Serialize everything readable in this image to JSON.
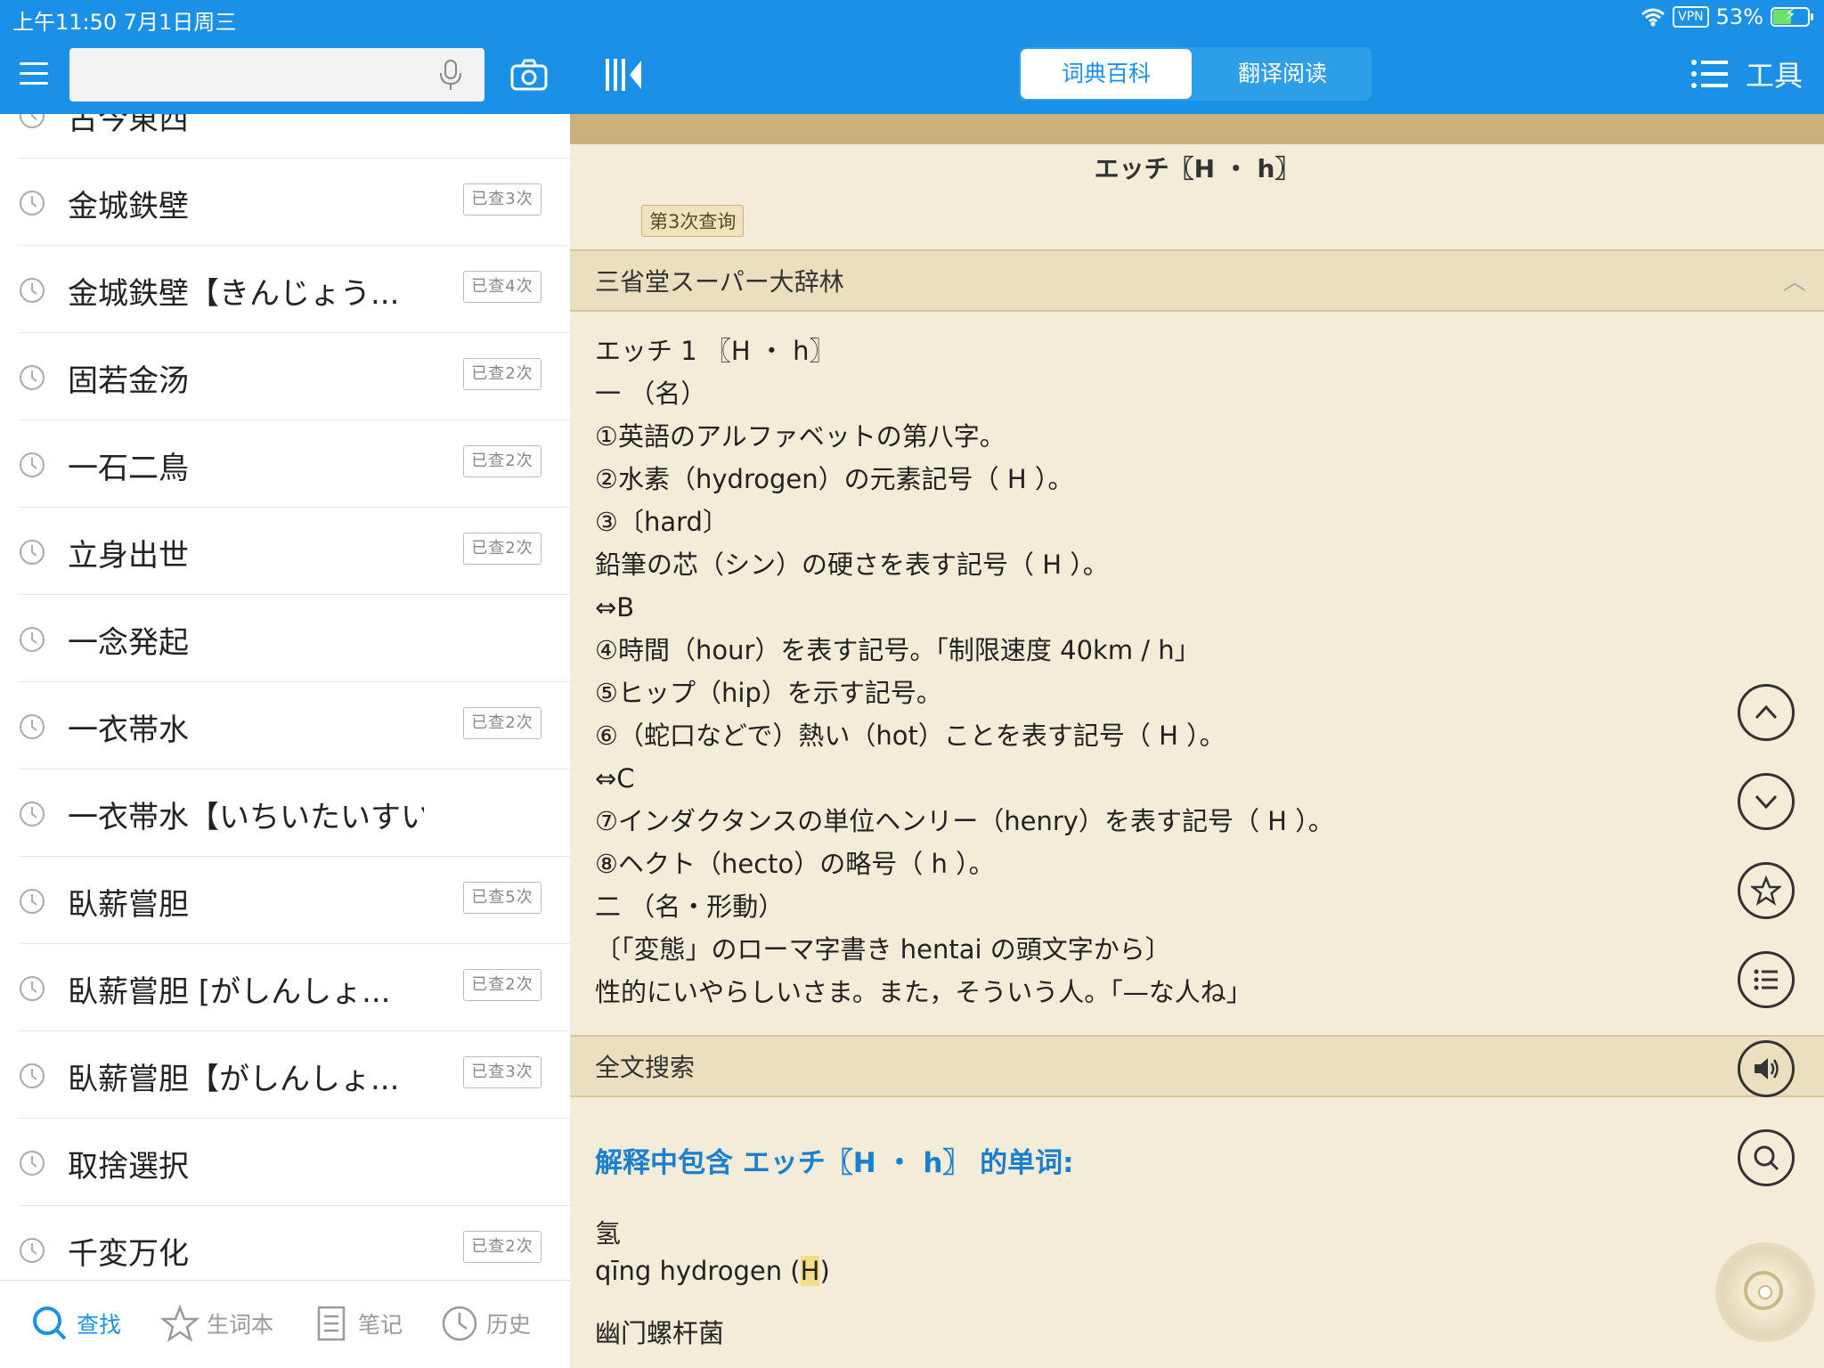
{
  "status": {
    "time": "上午11:50  7月1日周三",
    "vpn": "VPN",
    "battery": "53%"
  },
  "toolbar": {
    "search_placeholder": "",
    "segment": [
      "词典百科",
      "翻译阅读"
    ],
    "tools_label": "工具"
  },
  "history": [
    {
      "term": "古今東西",
      "count": ""
    },
    {
      "term": "金城鉄壁",
      "count": "已查3次"
    },
    {
      "term": "金城鉄壁【きんじょう...",
      "count": "已查4次"
    },
    {
      "term": "固若金汤",
      "count": "已查2次"
    },
    {
      "term": "一石二鳥",
      "count": "已查2次"
    },
    {
      "term": "立身出世",
      "count": "已查2次"
    },
    {
      "term": "一念発起",
      "count": ""
    },
    {
      "term": "一衣帯水",
      "count": "已查2次"
    },
    {
      "term": "一衣帯水【いちいたいすい】",
      "count": ""
    },
    {
      "term": "臥薪嘗胆",
      "count": "已查5次"
    },
    {
      "term": "臥薪嘗胆 [がしんしょ...",
      "count": "已查2次"
    },
    {
      "term": "臥薪嘗胆【がしんしょ...",
      "count": "已查3次"
    },
    {
      "term": "取捨選択",
      "count": ""
    },
    {
      "term": "千変万化",
      "count": "已查2次"
    }
  ],
  "tabs": [
    "查找",
    "生词本",
    "笔记",
    "历史"
  ],
  "entry": {
    "title": "エッチ〖H ・ h〗",
    "query_count": "第3次查询",
    "dictionary": "三省堂スーパー大辞林",
    "lines": [
      " エッチ 1 〖H ・ h〗",
      "一 （名）",
      "①英語のアルファベットの第八字。",
      "②水素（hydrogen）の元素記号（ H ）。",
      "③〔hard〕",
      "鉛筆の芯（シン）の硬さを表す記号（ H ）。",
      "⇔B",
      "④時間（hour）を表す記号。「制限速度 40km / h」",
      "⑤ヒップ（hip）を示す記号。",
      "⑥（蛇口などで）熱い（hot）ことを表す記号（ H ）。",
      "⇔C",
      "⑦インダクタンスの単位ヘンリー（henry）を表す記号（ H ）。",
      "⑧ヘクト（hecto）の略号（ h ）。",
      "二 （名・形動）",
      "〔「変態」のローマ字書き hentai の頭文字から〕",
      "性的にいやらしいさま。また，そういう人。「—な人ね」"
    ],
    "fulltext_label": "全文搜索",
    "results_head": "解释中包含 エッチ〖H ・ h〗 的单词:",
    "result1_word": "氢",
    "result1_def_pre": "qīng hydrogen (",
    "result1_def_hl": "H",
    "result1_def_post": ")",
    "result2_word": "幽门螺杆菌"
  }
}
